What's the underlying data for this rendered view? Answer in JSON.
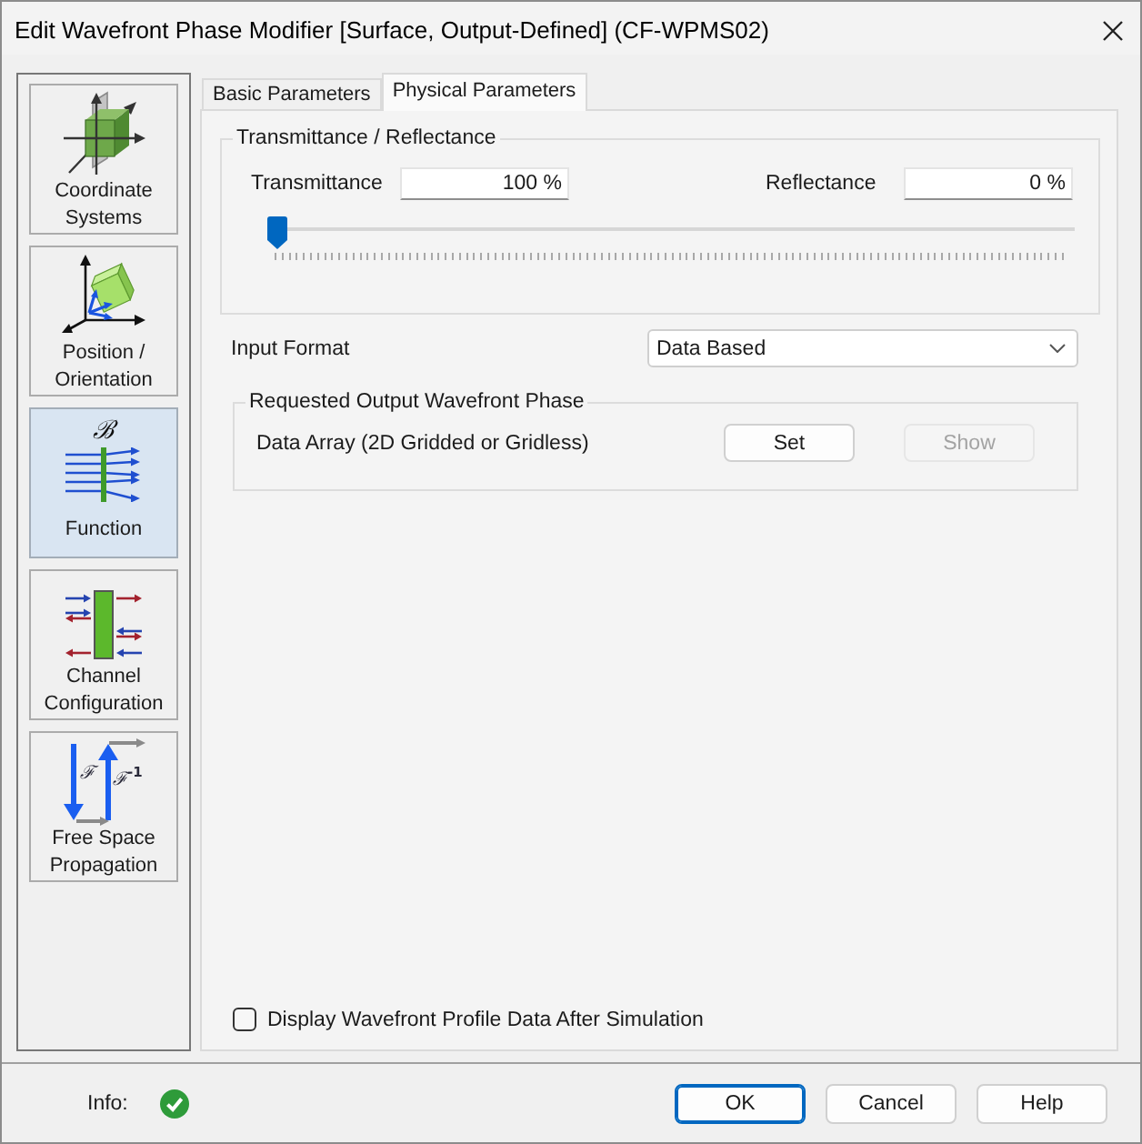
{
  "window": {
    "title": "Edit Wavefront Phase Modifier [Surface, Output-Defined] (CF-WPMS02)"
  },
  "sidebar": {
    "items": [
      {
        "kind": "coordinates",
        "label": "Coordinate Systems",
        "selected": false
      },
      {
        "kind": "orientation",
        "label": "Position / Orientation",
        "selected": false
      },
      {
        "kind": "function",
        "label": "Function",
        "selected": true,
        "symbols": [
          "ℬ"
        ]
      },
      {
        "kind": "channels",
        "label": "Channel Configuration",
        "selected": false
      },
      {
        "kind": "propagation",
        "label": "Free Space Propagation",
        "selected": false,
        "symbols": [
          "ℱ",
          "ℱ$^{-1}$"
        ]
      }
    ]
  },
  "tabs": [
    {
      "label": "Basic Parameters",
      "selected": false
    },
    {
      "label": "Physical Parameters",
      "selected": true
    }
  ],
  "transmittance_reflectance": {
    "title": "Transmittance / Reflectance",
    "fields": [
      {
        "label": "Transmittance",
        "value": "100 %"
      },
      {
        "label": "Reflectance",
        "value": "0 %"
      }
    ],
    "slider": {
      "level": 0
    }
  },
  "input_format": {
    "label": "Input Format",
    "value": "Data Based"
  },
  "output_phase": {
    "title": "Requested Output Wavefront Phase",
    "label": "Data Array (2D Gridded or Gridless)",
    "buttons": [
      {
        "label": "Set",
        "disabled": false
      },
      {
        "label": "Show",
        "disabled": true
      }
    ]
  },
  "display_option": {
    "label": "Display Wavefront Profile Data After Simulation",
    "checked": false
  },
  "footer": {
    "info": {
      "label": "Info:",
      "ok": true
    },
    "buttons": [
      {
        "label": "OK",
        "default": true
      },
      {
        "label": "Cancel",
        "default": false
      },
      {
        "label": "Help",
        "default": false
      }
    ]
  }
}
